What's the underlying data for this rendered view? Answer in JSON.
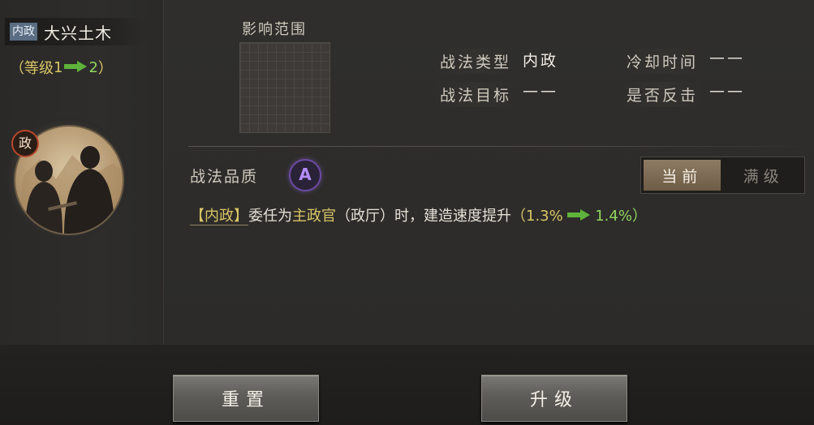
{
  "skill": {
    "category_tag": "内政",
    "name": "大兴土木",
    "level_open": "（等级",
    "level_from": "1",
    "level_to": "2",
    "level_close": "）",
    "portrait_badge": "政"
  },
  "range": {
    "title": "影响范围"
  },
  "info": {
    "type_label": "战法类型",
    "type_value": "内政",
    "cooldown_label": "冷却时间",
    "cooldown_value": "——",
    "target_label": "战法目标",
    "target_value": "——",
    "counter_label": "是否反击",
    "counter_value": "——"
  },
  "quality": {
    "label": "战法品质",
    "grade": "A"
  },
  "toggle": {
    "current": "当前",
    "max": "满级",
    "selected": "current"
  },
  "description": {
    "tag": "【内政】",
    "part1": "委任为",
    "highlight": "主政官",
    "part2": "（政厅）时，建造速度提升",
    "paren_open": "（",
    "from": "1.3%",
    "to": "1.4%",
    "paren_close": "）"
  },
  "buttons": {
    "reset": "重置",
    "upgrade": "升级"
  },
  "colors": {
    "accent_yellow": "#d9c566",
    "accent_green": "#8fd65e",
    "quality_purple": "#b48cff",
    "category_blue": "#5a6d83"
  },
  "icons": {
    "level_arrow": "green-right-arrow",
    "quality": "grade-a-badge"
  }
}
